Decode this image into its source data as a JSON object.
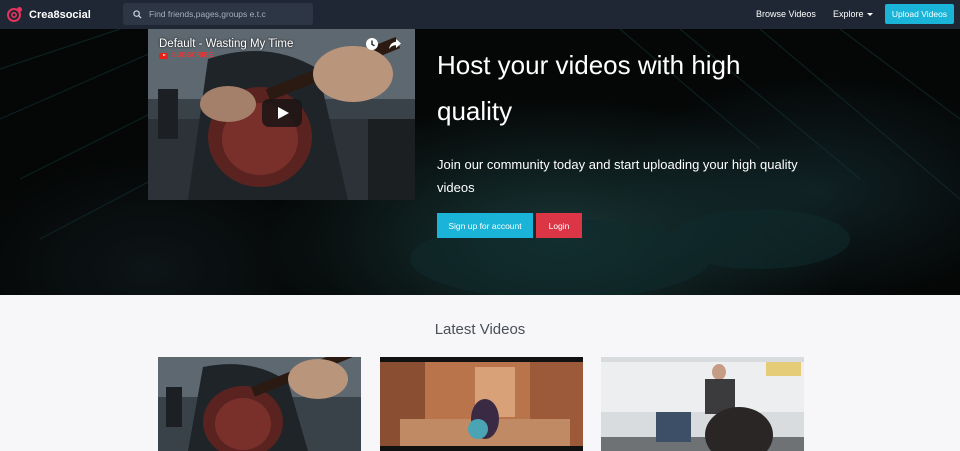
{
  "navbar": {
    "brand": "Crea8social",
    "search_placeholder": "Find friends,pages,groups e.t.c",
    "browse_label": "Browse Videos",
    "explore_label": "Explore",
    "upload_label": "Upload Videos"
  },
  "hero": {
    "player_title": "Default - Wasting My Time",
    "player_subscribe": "SUBSCRIBE",
    "title": "Host your videos with high quality",
    "text": "Join our community today and start uploading your high quality videos",
    "signup_label": "Sign up for account",
    "login_label": "Login"
  },
  "latest": {
    "title": "Latest Videos"
  },
  "colors": {
    "navbar": "#1e2733",
    "accent": "#1ab4d8",
    "danger": "#dc3545",
    "brand_icon": "#e5335e"
  },
  "icons": [
    "brand-logo-icon",
    "search-icon",
    "clock-icon",
    "share-icon",
    "play-icon",
    "youtube-icon"
  ]
}
